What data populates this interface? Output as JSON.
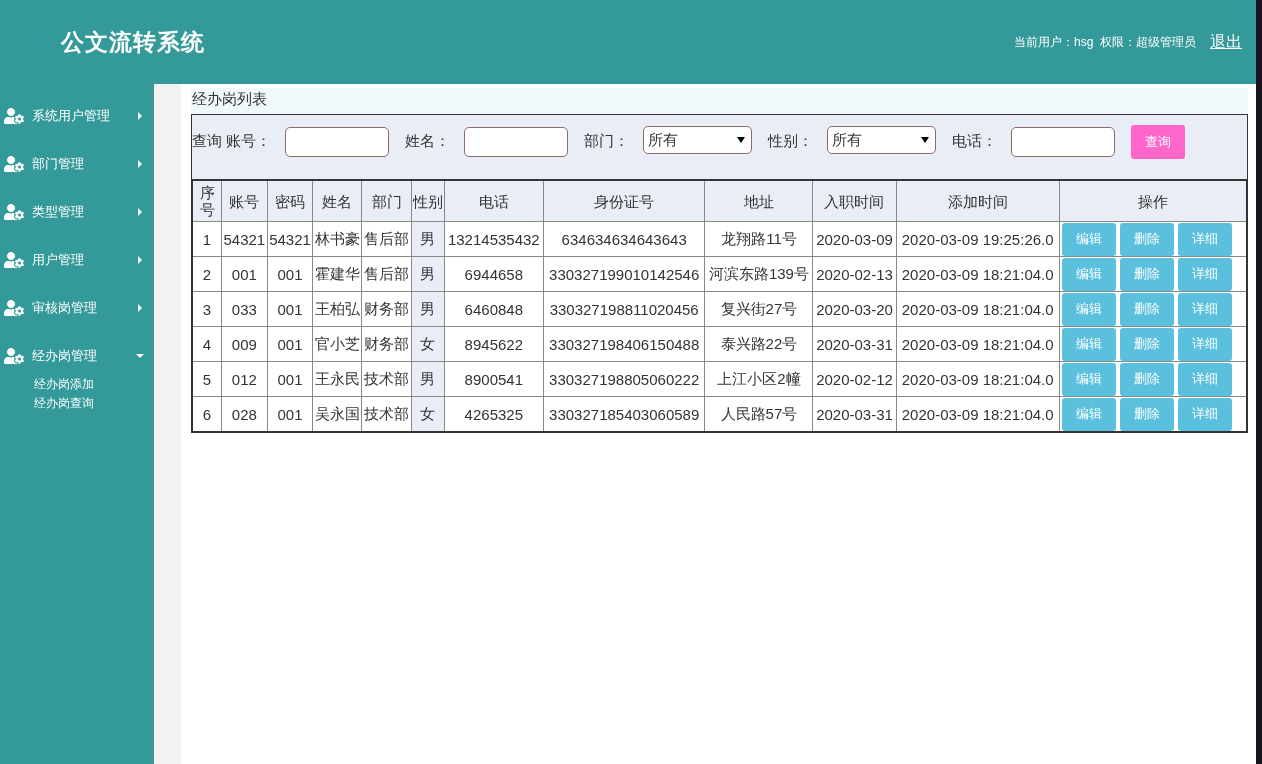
{
  "header": {
    "title": "公文流转系统",
    "user_info": "当前用户：hsg  权限：超级管理员",
    "logout": "退出"
  },
  "sidebar": {
    "items": [
      {
        "label": "系统用户管理",
        "expanded": false
      },
      {
        "label": "部门管理",
        "expanded": false
      },
      {
        "label": "类型管理",
        "expanded": false
      },
      {
        "label": "用户管理",
        "expanded": false
      },
      {
        "label": "审核岗管理",
        "expanded": false
      },
      {
        "label": "经办岗管理",
        "expanded": true,
        "children": [
          {
            "label": "经办岗添加"
          },
          {
            "label": "经办岗查询"
          }
        ]
      }
    ]
  },
  "panel_title": "经办岗列表",
  "filter": {
    "prefix": "查询",
    "fields": [
      {
        "kind": "input",
        "label": "账号："
      },
      {
        "kind": "input",
        "label": "姓名："
      },
      {
        "kind": "select",
        "label": "部门：",
        "value": "所有"
      },
      {
        "kind": "select",
        "label": "性别：",
        "value": "所有"
      },
      {
        "kind": "input",
        "label": "电话："
      }
    ],
    "button": "查询"
  },
  "table": {
    "columns": [
      "序号",
      "账号",
      "密码",
      "姓名",
      "部门",
      "性别",
      "电话",
      "身份证号",
      "地址",
      "入职时间",
      "添加时间",
      "操作"
    ],
    "rows": [
      {
        "cells": [
          "1",
          "54321",
          "54321",
          "林书豪",
          "售后部",
          "男",
          "13214535432",
          "634634634643643",
          "龙翔路11号",
          "2020-03-09",
          "2020-03-09 19:25:26.0"
        ],
        "actions": [
          "编辑",
          "删除",
          "详细"
        ]
      },
      {
        "cells": [
          "2",
          "001",
          "001",
          "霍建华",
          "售后部",
          "男",
          "6944658",
          "330327199010142546",
          "河滨东路139号",
          "2020-02-13",
          "2020-03-09 18:21:04.0"
        ],
        "actions": [
          "编辑",
          "删除",
          "详细"
        ]
      },
      {
        "cells": [
          "3",
          "033",
          "001",
          "王柏弘",
          "财务部",
          "男",
          "6460848",
          "330327198811020456",
          "复兴街27号",
          "2020-03-20",
          "2020-03-09 18:21:04.0"
        ],
        "actions": [
          "编辑",
          "删除",
          "详细"
        ]
      },
      {
        "cells": [
          "4",
          "009",
          "001",
          "官小芝",
          "财务部",
          "女",
          "8945622",
          "330327198406150488",
          "泰兴路22号",
          "2020-03-31",
          "2020-03-09 18:21:04.0"
        ],
        "actions": [
          "编辑",
          "删除",
          "详细"
        ]
      },
      {
        "cells": [
          "5",
          "012",
          "001",
          "王永民",
          "技术部",
          "男",
          "8900541",
          "330327198805060222",
          "上江小区2幢",
          "2020-02-12",
          "2020-03-09 18:21:04.0"
        ],
        "actions": [
          "编辑",
          "删除",
          "详细"
        ]
      },
      {
        "cells": [
          "6",
          "028",
          "001",
          "吴永国",
          "技术部",
          "女",
          "4265325",
          "330327185403060589",
          "人民路57号",
          "2020-03-31",
          "2020-03-09 18:21:04.0"
        ],
        "actions": [
          "编辑",
          "删除",
          "详细"
        ]
      }
    ]
  }
}
